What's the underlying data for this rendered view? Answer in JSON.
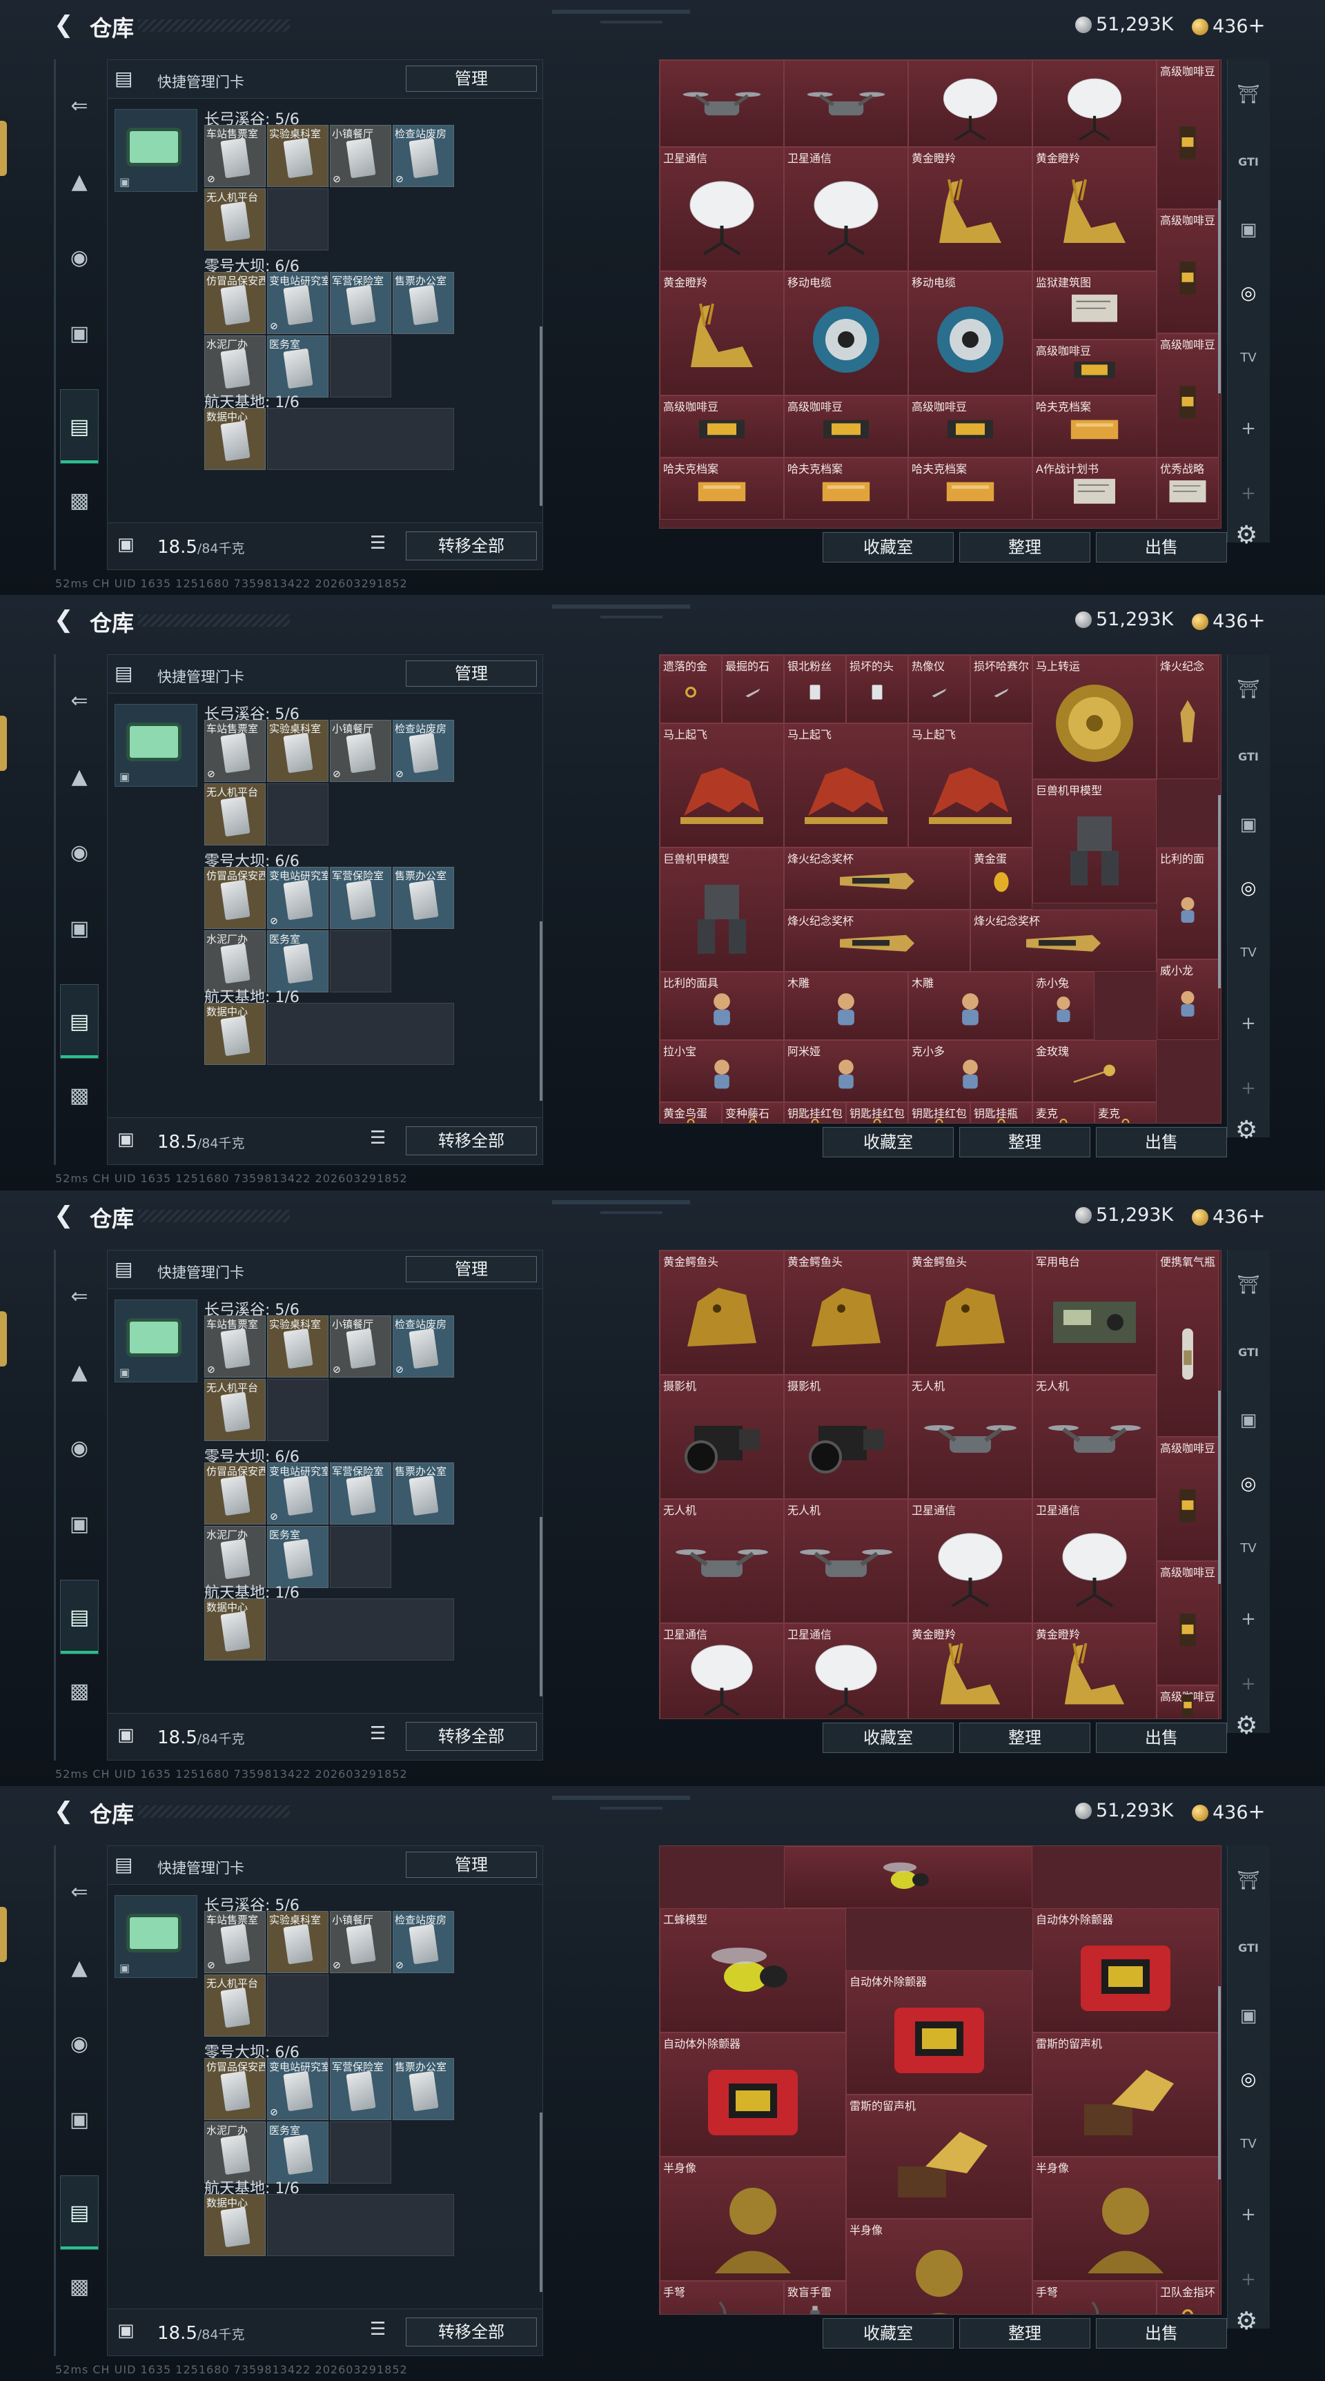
{
  "app": {
    "title": "仓库",
    "back_icon": "back-arrow-icon"
  },
  "currency": {
    "silver": "51,293K",
    "gold": "436",
    "gold_plus": "+"
  },
  "sidenav": [
    "gun-icon",
    "armor-icon",
    "helmet-icon",
    "backpack-icon",
    "keycard-icon",
    "briefcase-icon"
  ],
  "left_panel": {
    "header_label": "快捷管理门卡",
    "manage_button": "管理",
    "groups": [
      {
        "title": "长弓溪谷: 5/6",
        "cards": [
          {
            "name": "车站售票室",
            "tone": "gray",
            "locked": true
          },
          {
            "name": "实验桌科室",
            "tone": "gold",
            "locked": false
          },
          {
            "name": "小镇餐厅",
            "tone": "gray",
            "locked": true
          },
          {
            "name": "检查站废房",
            "tone": "blue",
            "locked": true
          },
          {
            "name": "无人机平台",
            "tone": "gold",
            "locked": false
          }
        ]
      },
      {
        "title": "零号大坝: 6/6",
        "cards": [
          {
            "name": "仿冒品保安西",
            "tone": "gold",
            "locked": false
          },
          {
            "name": "变电站研究室",
            "tone": "blue",
            "locked": true
          },
          {
            "name": "军营保险室",
            "tone": "blue",
            "locked": false
          },
          {
            "name": "售票办公室",
            "tone": "blue",
            "locked": false
          },
          {
            "name": "水泥厂办",
            "tone": "gray",
            "locked": false
          },
          {
            "name": "医务室",
            "tone": "blue",
            "locked": false
          }
        ]
      },
      {
        "title": "航天基地: 1/6",
        "cards": [
          {
            "name": "数据中心",
            "tone": "gold",
            "locked": false
          }
        ]
      }
    ],
    "weight": "18.5",
    "weight_max": "/84千克",
    "transfer_button": "转移全部"
  },
  "right_panel": {
    "buttons": [
      "收藏室",
      "整理",
      "出售"
    ],
    "rail": [
      "safe-icon",
      "gti-icon",
      "vault-icon",
      "vault-active-icon",
      "tv-icon",
      "add-icon",
      "add-icon-2"
    ]
  },
  "footer_text": "52ms CH UID 1635 1251680 7359813422 202603291852",
  "screens": [
    {
      "cells": [
        {
          "label": "",
          "kind": "drone",
          "c": 0,
          "r": 0,
          "w": 1,
          "h": 0.7
        },
        {
          "label": "",
          "kind": "drone",
          "c": 1,
          "r": 0,
          "w": 1,
          "h": 0.7
        },
        {
          "label": "",
          "kind": "dish",
          "c": 2,
          "r": 0,
          "w": 1,
          "h": 0.7
        },
        {
          "label": "",
          "kind": "dish",
          "c": 3,
          "r": 0,
          "w": 1,
          "h": 0.7
        },
        {
          "label": "高级咖啡豆",
          "kind": "coffee",
          "c": 4,
          "r": 0,
          "w": 0.5,
          "h": 1.2
        },
        {
          "label": "卫星通信",
          "kind": "dish",
          "c": 0,
          "r": 0.7,
          "w": 1,
          "h": 1
        },
        {
          "label": "卫星通信",
          "kind": "dish",
          "c": 1,
          "r": 0.7,
          "w": 1,
          "h": 1
        },
        {
          "label": "黄金瞪羚",
          "kind": "gazelle",
          "c": 2,
          "r": 0.7,
          "w": 1,
          "h": 1
        },
        {
          "label": "黄金瞪羚",
          "kind": "gazelle",
          "c": 3,
          "r": 0.7,
          "w": 1,
          "h": 1
        },
        {
          "label": "高级咖啡豆",
          "kind": "coffee",
          "c": 4,
          "r": 1.2,
          "w": 0.5,
          "h": 1
        },
        {
          "label": "黄金瞪羚",
          "kind": "gazelle",
          "c": 0,
          "r": 1.7,
          "w": 1,
          "h": 1
        },
        {
          "label": "移动电缆",
          "kind": "cable",
          "c": 1,
          "r": 1.7,
          "w": 1,
          "h": 1
        },
        {
          "label": "移动电缆",
          "kind": "cable",
          "c": 2,
          "r": 1.7,
          "w": 1,
          "h": 1
        },
        {
          "label": "监狱建筑图",
          "kind": "paper",
          "c": 3,
          "r": 1.7,
          "w": 1,
          "h": 0.55
        },
        {
          "label": "高级咖啡豆",
          "kind": "coffee",
          "c": 4,
          "r": 2.2,
          "w": 0.5,
          "h": 1
        },
        {
          "label": "高级咖啡豆",
          "kind": "box",
          "c": 3,
          "r": 2.25,
          "w": 1,
          "h": 0.45
        },
        {
          "label": "高级咖啡豆",
          "kind": "box",
          "c": 0,
          "r": 2.7,
          "w": 1,
          "h": 0.5
        },
        {
          "label": "高级咖啡豆",
          "kind": "box",
          "c": 1,
          "r": 2.7,
          "w": 1,
          "h": 0.5
        },
        {
          "label": "高级咖啡豆",
          "kind": "box",
          "c": 2,
          "r": 2.7,
          "w": 1,
          "h": 0.5
        },
        {
          "label": "哈夫克档案",
          "kind": "folder",
          "c": 3,
          "r": 2.7,
          "w": 1,
          "h": 0.5
        },
        {
          "label": "哈夫克档案",
          "kind": "folder",
          "c": 0,
          "r": 3.2,
          "w": 1,
          "h": 0.5
        },
        {
          "label": "哈夫克档案",
          "kind": "folder",
          "c": 1,
          "r": 3.2,
          "w": 1,
          "h": 0.5
        },
        {
          "label": "哈夫克档案",
          "kind": "folder",
          "c": 2,
          "r": 3.2,
          "w": 1,
          "h": 0.5
        },
        {
          "label": "A作战计划书",
          "kind": "paper",
          "c": 3,
          "r": 3.2,
          "w": 1,
          "h": 0.5
        },
        {
          "label": "优秀战略",
          "kind": "paper",
          "c": 4,
          "r": 3.2,
          "w": 0.5,
          "h": 0.5
        }
      ]
    },
    {
      "cells": [
        {
          "label": "遗落的金",
          "kind": "ring",
          "c": 0,
          "r": 0,
          "w": 0.5,
          "h": 0.55
        },
        {
          "label": "最掘的石",
          "kind": "knife",
          "c": 0.5,
          "r": 0,
          "w": 0.5,
          "h": 0.55
        },
        {
          "label": "银北粉丝",
          "kind": "card",
          "c": 1,
          "r": 0,
          "w": 0.5,
          "h": 0.55
        },
        {
          "label": "损坏的头",
          "kind": "card",
          "c": 1.5,
          "r": 0,
          "w": 0.5,
          "h": 0.55
        },
        {
          "label": "热像仪",
          "kind": "knife",
          "c": 2,
          "r": 0,
          "w": 0.5,
          "h": 0.55
        },
        {
          "label": "损坏哈赛尔",
          "kind": "knife",
          "c": 2.5,
          "r": 0,
          "w": 0.5,
          "h": 0.55
        },
        {
          "label": "马上转运",
          "kind": "wheel",
          "c": 3,
          "r": 0,
          "w": 1,
          "h": 1
        },
        {
          "label": "烽火纪念",
          "kind": "trophy",
          "c": 4,
          "r": 0,
          "w": 0.5,
          "h": 1
        },
        {
          "label": "马上起飞",
          "kind": "horse",
          "c": 0,
          "r": 0.55,
          "w": 1,
          "h": 1
        },
        {
          "label": "马上起飞",
          "kind": "horse",
          "c": 1,
          "r": 0.55,
          "w": 1,
          "h": 1
        },
        {
          "label": "马上起飞",
          "kind": "horse",
          "c": 2,
          "r": 0.55,
          "w": 1,
          "h": 1
        },
        {
          "label": "巨兽机甲模型",
          "kind": "mech",
          "c": 3,
          "r": 1,
          "w": 1,
          "h": 1
        },
        {
          "label": "比利的面",
          "kind": "doll",
          "c": 4,
          "r": 1.55,
          "w": 0.5,
          "h": 0.9
        },
        {
          "label": "巨兽机甲模型",
          "kind": "mech",
          "c": 0,
          "r": 1.55,
          "w": 1,
          "h": 1
        },
        {
          "label": "烽火纪念奖杯",
          "kind": "bar",
          "c": 1,
          "r": 1.55,
          "w": 1.5,
          "h": 0.5
        },
        {
          "label": "黄金蛋",
          "kind": "egg",
          "c": 2.5,
          "r": 1.55,
          "w": 0.5,
          "h": 0.5
        },
        {
          "label": "烽火纪念奖杯",
          "kind": "bar",
          "c": 1,
          "r": 2.05,
          "w": 1.5,
          "h": 0.5
        },
        {
          "label": "烽火纪念奖杯",
          "kind": "bar",
          "c": 2.5,
          "r": 2.05,
          "w": 1.5,
          "h": 0.5
        },
        {
          "label": "比利的面具",
          "kind": "doll",
          "c": 0,
          "r": 2.55,
          "w": 1,
          "h": 0.55
        },
        {
          "label": "木雕",
          "kind": "doll",
          "c": 1,
          "r": 2.55,
          "w": 1,
          "h": 0.55
        },
        {
          "label": "木雕",
          "kind": "doll",
          "c": 2,
          "r": 2.55,
          "w": 1,
          "h": 0.55
        },
        {
          "label": "赤小兔",
          "kind": "doll",
          "c": 3,
          "r": 2.55,
          "w": 0.5,
          "h": 0.55
        },
        {
          "label": "威小龙",
          "kind": "doll",
          "c": 4,
          "r": 2.45,
          "w": 0.5,
          "h": 0.65
        },
        {
          "label": "拉小宝",
          "kind": "doll",
          "c": 0,
          "r": 3.1,
          "w": 1,
          "h": 0.5
        },
        {
          "label": "阿米娅",
          "kind": "doll",
          "c": 1,
          "r": 3.1,
          "w": 1,
          "h": 0.5
        },
        {
          "label": "克小多",
          "kind": "doll",
          "c": 2,
          "r": 3.1,
          "w": 1,
          "h": 0.5
        },
        {
          "label": "金玫瑰",
          "kind": "rose",
          "c": 3,
          "r": 3.1,
          "w": 1,
          "h": 0.5
        },
        {
          "label": "黄金鸟蛋",
          "kind": "ring",
          "c": 0,
          "r": 3.6,
          "w": 0.5,
          "h": 0.3
        },
        {
          "label": "变种藤石",
          "kind": "ring",
          "c": 0.5,
          "r": 3.6,
          "w": 0.5,
          "h": 0.3
        },
        {
          "label": "钥匙挂红包",
          "kind": "ring",
          "c": 1,
          "r": 3.6,
          "w": 0.5,
          "h": 0.3
        },
        {
          "label": "钥匙挂红包",
          "kind": "ring",
          "c": 1.5,
          "r": 3.6,
          "w": 0.5,
          "h": 0.3
        },
        {
          "label": "钥匙挂红包",
          "kind": "ring",
          "c": 2,
          "r": 3.6,
          "w": 0.5,
          "h": 0.3
        },
        {
          "label": "钥匙挂瓶",
          "kind": "ring",
          "c": 2.5,
          "r": 3.6,
          "w": 0.5,
          "h": 0.3
        },
        {
          "label": "麦克",
          "kind": "ring",
          "c": 3,
          "r": 3.6,
          "w": 0.5,
          "h": 0.3
        },
        {
          "label": "麦克",
          "kind": "ring",
          "c": 3.5,
          "r": 3.6,
          "w": 0.5,
          "h": 0.3
        }
      ]
    },
    {
      "cells": [
        {
          "label": "黄金鳄鱼头",
          "kind": "croc",
          "c": 0,
          "r": 0,
          "w": 1,
          "h": 1
        },
        {
          "label": "黄金鳄鱼头",
          "kind": "croc",
          "c": 1,
          "r": 0,
          "w": 1,
          "h": 1
        },
        {
          "label": "黄金鳄鱼头",
          "kind": "croc",
          "c": 2,
          "r": 0,
          "w": 1,
          "h": 1
        },
        {
          "label": "军用电台",
          "kind": "radio",
          "c": 3,
          "r": 0,
          "w": 1,
          "h": 1
        },
        {
          "label": "便携氧气瓶",
          "kind": "tank",
          "c": 4,
          "r": 0,
          "w": 0.5,
          "h": 1.5
        },
        {
          "label": "摄影机",
          "kind": "camera",
          "c": 0,
          "r": 1,
          "w": 1,
          "h": 1
        },
        {
          "label": "摄影机",
          "kind": "camera",
          "c": 1,
          "r": 1,
          "w": 1,
          "h": 1
        },
        {
          "label": "无人机",
          "kind": "drone",
          "c": 2,
          "r": 1,
          "w": 1,
          "h": 1
        },
        {
          "label": "无人机",
          "kind": "drone",
          "c": 3,
          "r": 1,
          "w": 1,
          "h": 1
        },
        {
          "label": "高级咖啡豆",
          "kind": "coffee",
          "c": 4,
          "r": 1.5,
          "w": 0.5,
          "h": 1
        },
        {
          "label": "无人机",
          "kind": "drone",
          "c": 0,
          "r": 2,
          "w": 1,
          "h": 1
        },
        {
          "label": "无人机",
          "kind": "drone",
          "c": 1,
          "r": 2,
          "w": 1,
          "h": 1
        },
        {
          "label": "卫星通信",
          "kind": "dish",
          "c": 2,
          "r": 2,
          "w": 1,
          "h": 1
        },
        {
          "label": "卫星通信",
          "kind": "dish",
          "c": 3,
          "r": 2,
          "w": 1,
          "h": 1
        },
        {
          "label": "高级咖啡豆",
          "kind": "coffee",
          "c": 4,
          "r": 2.5,
          "w": 0.5,
          "h": 1
        },
        {
          "label": "卫星通信",
          "kind": "dish",
          "c": 0,
          "r": 3,
          "w": 1,
          "h": 0.8
        },
        {
          "label": "卫星通信",
          "kind": "dish",
          "c": 1,
          "r": 3,
          "w": 1,
          "h": 0.8
        },
        {
          "label": "黄金瞪羚",
          "kind": "gazelle",
          "c": 2,
          "r": 3,
          "w": 1,
          "h": 0.8
        },
        {
          "label": "黄金瞪羚",
          "kind": "gazelle",
          "c": 3,
          "r": 3,
          "w": 1,
          "h": 0.8
        },
        {
          "label": "高级咖啡豆",
          "kind": "coffee",
          "c": 4,
          "r": 3.5,
          "w": 0.5,
          "h": 0.3
        }
      ]
    },
    {
      "cells": [
        {
          "label": "",
          "kind": "wasp",
          "c": 1,
          "r": 0,
          "w": 2,
          "h": 0.5
        },
        {
          "label": "工蜂模型",
          "kind": "wasp",
          "c": 0,
          "r": 0.5,
          "w": 1.5,
          "h": 1
        },
        {
          "label": "自动体外除颤器",
          "kind": "aed",
          "c": 3,
          "r": 0.5,
          "w": 1.5,
          "h": 1
        },
        {
          "label": "自动体外除颤器",
          "kind": "aed",
          "c": 1.5,
          "r": 1,
          "w": 1.5,
          "h": 1
        },
        {
          "label": "自动体外除颤器",
          "kind": "aed",
          "c": 0,
          "r": 1.5,
          "w": 1.5,
          "h": 1
        },
        {
          "label": "雷斯的留声机",
          "kind": "gramo",
          "c": 3,
          "r": 1.5,
          "w": 1.5,
          "h": 1
        },
        {
          "label": "雷斯的留声机",
          "kind": "gramo",
          "c": 1.5,
          "r": 2,
          "w": 1.5,
          "h": 1
        },
        {
          "label": "半身像",
          "kind": "bust",
          "c": 0,
          "r": 2.5,
          "w": 1.5,
          "h": 1
        },
        {
          "label": "半身像",
          "kind": "bust",
          "c": 3,
          "r": 2.5,
          "w": 1.5,
          "h": 1
        },
        {
          "label": "半身像",
          "kind": "bust",
          "c": 1.5,
          "r": 3,
          "w": 1.5,
          "h": 1
        },
        {
          "label": "手弩",
          "kind": "crossbow",
          "c": 0,
          "r": 3.5,
          "w": 1,
          "h": 0.5
        },
        {
          "label": "致盲手雷",
          "kind": "grenade",
          "c": 1,
          "r": 3.5,
          "w": 0.5,
          "h": 0.5
        },
        {
          "label": "手弩",
          "kind": "crossbow",
          "c": 3,
          "r": 3.5,
          "w": 1,
          "h": 0.5
        },
        {
          "label": "卫队金指环",
          "kind": "ring",
          "c": 4,
          "r": 3.5,
          "w": 0.5,
          "h": 0.5
        }
      ]
    }
  ],
  "colors": {
    "accent_green": "#27c28b",
    "cell_red": "#5a2229",
    "panel": "#172029"
  }
}
